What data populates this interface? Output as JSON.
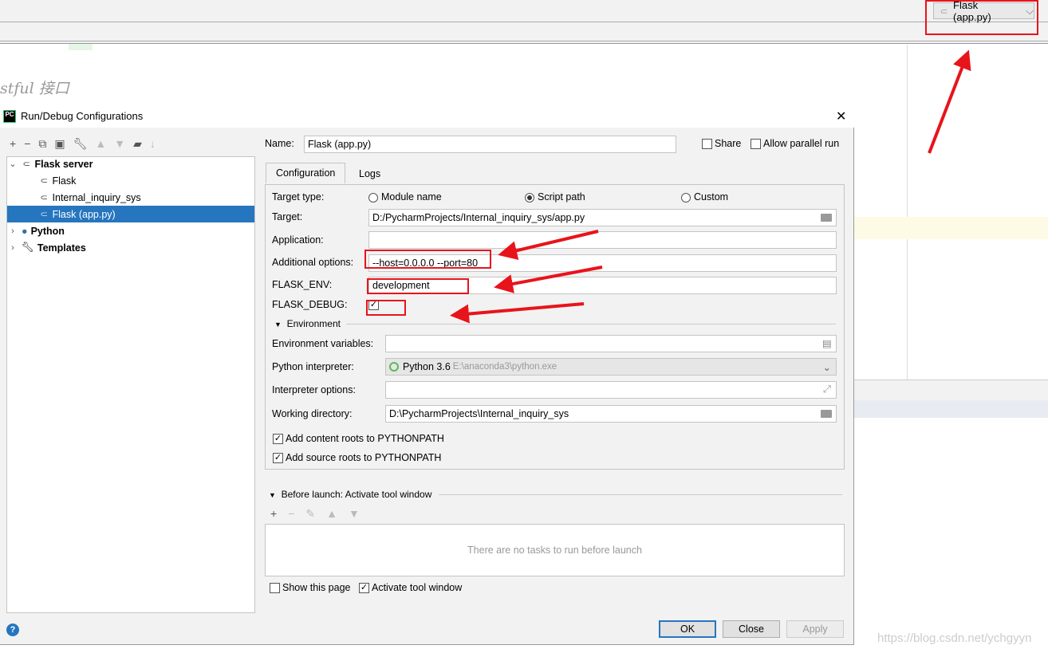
{
  "ide": {
    "code_comment": "stful 接口",
    "run_config_combo": "Flask (app.py)",
    "watermark": "https://blog.csdn.net/ychgyyn"
  },
  "dialog": {
    "title": "Run/Debug Configurations",
    "tree": [
      {
        "label": "Flask server",
        "level": 0,
        "expanded": true,
        "bold": true,
        "icon": "flask-icon"
      },
      {
        "label": "Flask",
        "level": 1,
        "icon": "flask-icon"
      },
      {
        "label": "Internal_inquiry_sys",
        "level": 1,
        "icon": "flask-icon"
      },
      {
        "label": "Flask (app.py)",
        "level": 1,
        "selected": true,
        "icon": "flask-icon"
      },
      {
        "label": "Python",
        "level": 0,
        "expanded": false,
        "bold": true,
        "icon": "python-icon"
      },
      {
        "label": "Templates",
        "level": 0,
        "expanded": false,
        "bold": true,
        "icon": "wrench-icon"
      }
    ],
    "name_label": "Name:",
    "name_value": "Flask (app.py)",
    "share_label": "Share",
    "share_checked": false,
    "parallel_label": "Allow parallel run",
    "parallel_checked": false,
    "tabs": [
      "Configuration",
      "Logs"
    ],
    "active_tab": "Configuration",
    "config": {
      "target_type_label": "Target type:",
      "target_types": [
        "Module name",
        "Script path",
        "Custom"
      ],
      "target_type_selected": "Script path",
      "target_label": "Target:",
      "target_value": "D:/PycharmProjects/Internal_inquiry_sys/app.py",
      "application_label": "Application:",
      "application_value": "",
      "additional_label": "Additional options:",
      "additional_value": "--host=0.0.0.0 --port=80",
      "flask_env_label": "FLASK_ENV:",
      "flask_env_value": "development",
      "flask_debug_label": "FLASK_DEBUG:",
      "flask_debug_checked": true,
      "environment_section": "Environment",
      "env_vars_label": "Environment variables:",
      "env_vars_value": "",
      "interpreter_label": "Python interpreter:",
      "interpreter_name": "Python 3.6",
      "interpreter_path": "E:\\anaconda3\\python.exe",
      "interp_options_label": "Interpreter options:",
      "interp_options_value": "",
      "workdir_label": "Working directory:",
      "workdir_value": "D:\\PycharmProjects\\Internal_inquiry_sys",
      "content_roots_label": "Add content roots to PYTHONPATH",
      "content_roots_checked": true,
      "source_roots_label": "Add source roots to PYTHONPATH",
      "source_roots_checked": true
    },
    "before_launch": {
      "title": "Before launch: Activate tool window",
      "empty_text": "There are no tasks to run before launch"
    },
    "show_page_label": "Show this page",
    "show_page_checked": false,
    "activate_label": "Activate tool window",
    "activate_checked": true,
    "buttons": {
      "ok": "OK",
      "close": "Close",
      "apply": "Apply"
    },
    "annotation_color": "#e8141b",
    "selection_color": "#2675bf"
  }
}
